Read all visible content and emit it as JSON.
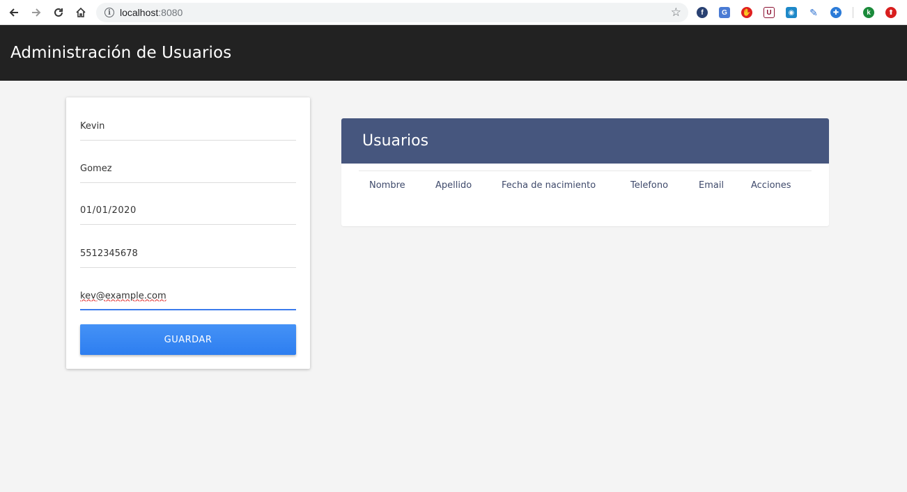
{
  "browser": {
    "url_host": "localhost",
    "url_port": ":8080",
    "extensions": [
      {
        "icon": "fedora-icon",
        "color": "#294172",
        "glyph": "f"
      },
      {
        "icon": "translate-icon",
        "color": "#4a7bd4",
        "glyph": "G"
      },
      {
        "icon": "adblock-icon",
        "color": "#e02020",
        "glyph": "✋"
      },
      {
        "icon": "privacy-icon",
        "color": "#8b1030",
        "glyph": "U"
      },
      {
        "icon": "screenshot-icon",
        "color": "#1e88c8",
        "glyph": "◉"
      },
      {
        "icon": "feather-icon",
        "color": "#2a6fd0",
        "glyph": "✎"
      },
      {
        "icon": "vpn-icon",
        "color": "#2b7bd8",
        "glyph": "✚"
      },
      {
        "icon": "profile-icon",
        "color": "#1a8a3a",
        "glyph": "k"
      },
      {
        "icon": "update-icon",
        "color": "#d81e1e",
        "glyph": "⬆"
      }
    ]
  },
  "header": {
    "title": "Administración de Usuarios"
  },
  "form": {
    "nombre": "Kevin",
    "apellido": "Gomez",
    "fecha": "01/01/2020",
    "telefono": "5512345678",
    "email": "kev@example.com",
    "save_label": "GUARDAR"
  },
  "table": {
    "title": "Usuarios",
    "columns": [
      "Nombre",
      "Apellido",
      "Fecha de nacimiento",
      "Telefono",
      "Email",
      "Acciones"
    ]
  },
  "colors": {
    "header_bg": "#222222",
    "table_header_bg": "#46567e",
    "accent": "#3b7bec"
  }
}
